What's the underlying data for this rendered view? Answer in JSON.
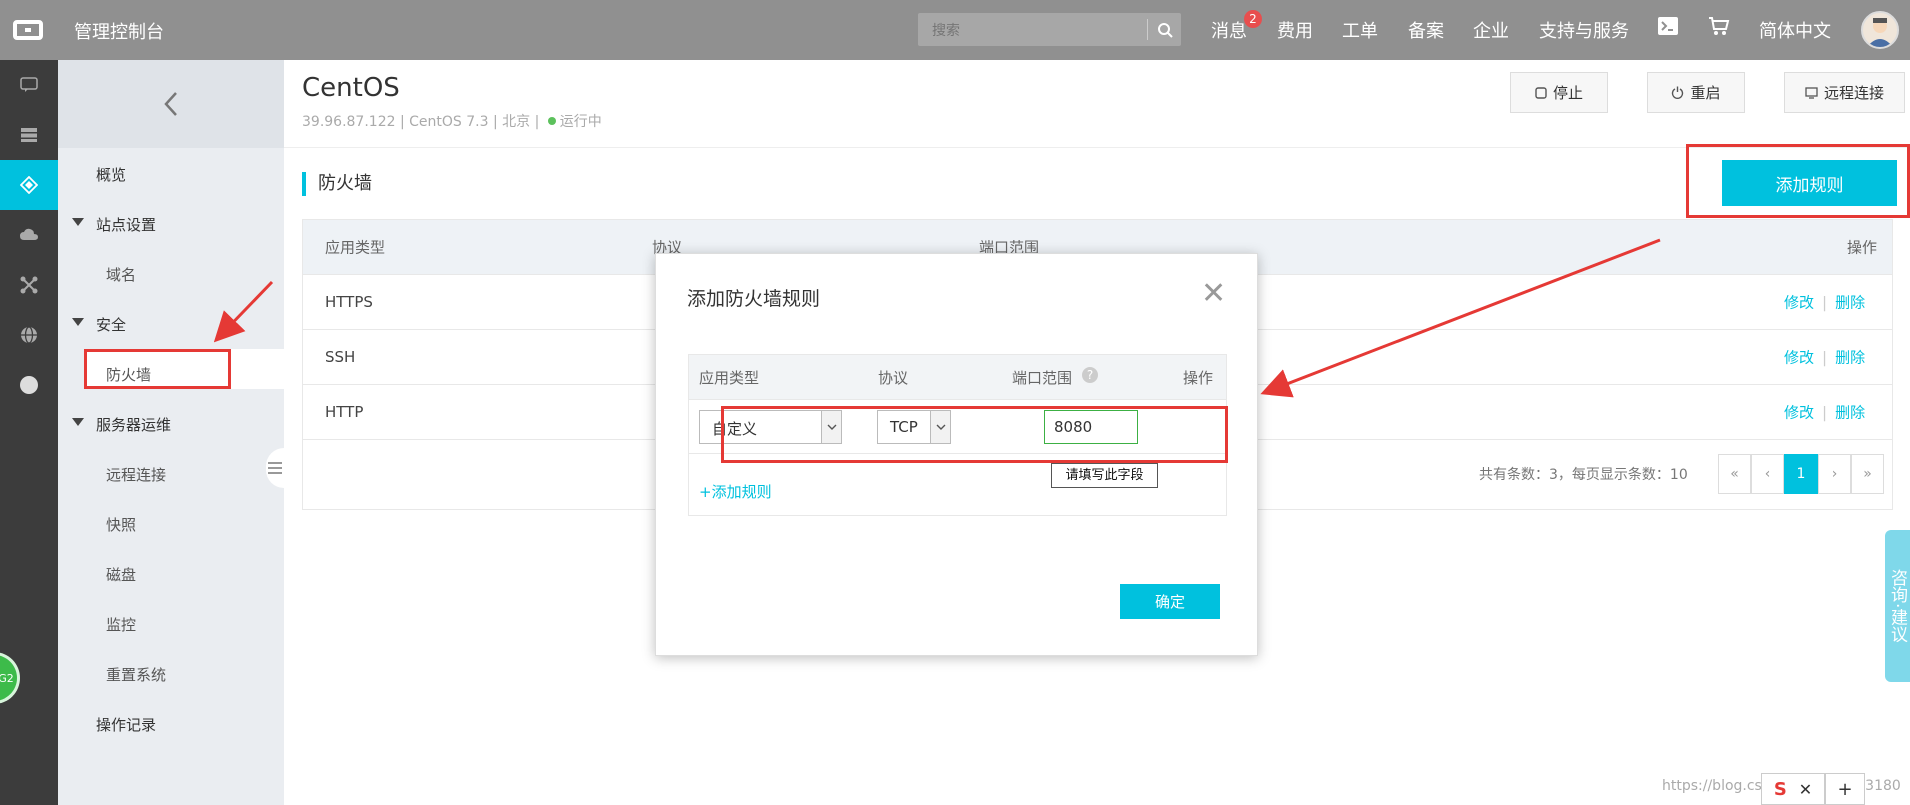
{
  "topbar": {
    "title": "管理控制台",
    "search_placeholder": "搜索",
    "nav": [
      "消息",
      "费用",
      "工单",
      "备案",
      "企业",
      "支持与服务"
    ],
    "message_badge": "2",
    "language": "简体中文"
  },
  "rail": {
    "icons": [
      "chat-icon",
      "server-icon",
      "cube-icon",
      "cloud-icon",
      "network-icon",
      "globe-icon",
      "circle-icon"
    ],
    "active_index": 2
  },
  "sidebar": {
    "overview": "概览",
    "site_settings": "站点设置",
    "domain": "域名",
    "security": "安全",
    "firewall": "防火墙",
    "ops": "服务器运维",
    "remote": "远程连接",
    "snapshot": "快照",
    "disk": "磁盘",
    "monitor": "监控",
    "reset": "重置系统",
    "logs": "操作记录"
  },
  "header": {
    "title": "CentOS",
    "ip": "39.96.87.122",
    "os": "CentOS 7.3",
    "region": "北京",
    "status": "运行中",
    "stop": "停止",
    "restart": "重启",
    "remote": "远程连接"
  },
  "section": {
    "title": "防火墙",
    "add_rule": "添加规则"
  },
  "table": {
    "columns": [
      "应用类型",
      "协议",
      "端口范围",
      "操作"
    ],
    "rows": [
      {
        "type": "HTTPS"
      },
      {
        "type": "SSH"
      },
      {
        "type": "HTTP"
      }
    ],
    "edit": "修改",
    "delete": "删除",
    "footer": "共有条数：3，每页显示条数：10",
    "pager": [
      "«",
      "‹",
      "1",
      "›",
      "»"
    ]
  },
  "modal": {
    "title": "添加防火墙规则",
    "columns": [
      "应用类型",
      "协议",
      "端口范围",
      "操作"
    ],
    "app_type": "自定义",
    "protocol": "TCP",
    "port": "8080",
    "tooltip": "请填写此字段",
    "add_link": "+添加规则",
    "confirm": "确定"
  },
  "consult": "咨询·建议",
  "watermark": "https://blog.csdn.net/u013453180",
  "colors": {
    "accent": "#00c1de",
    "topbar": "#909090",
    "rail": "#3c3c3c",
    "annotation": "#e53935"
  }
}
